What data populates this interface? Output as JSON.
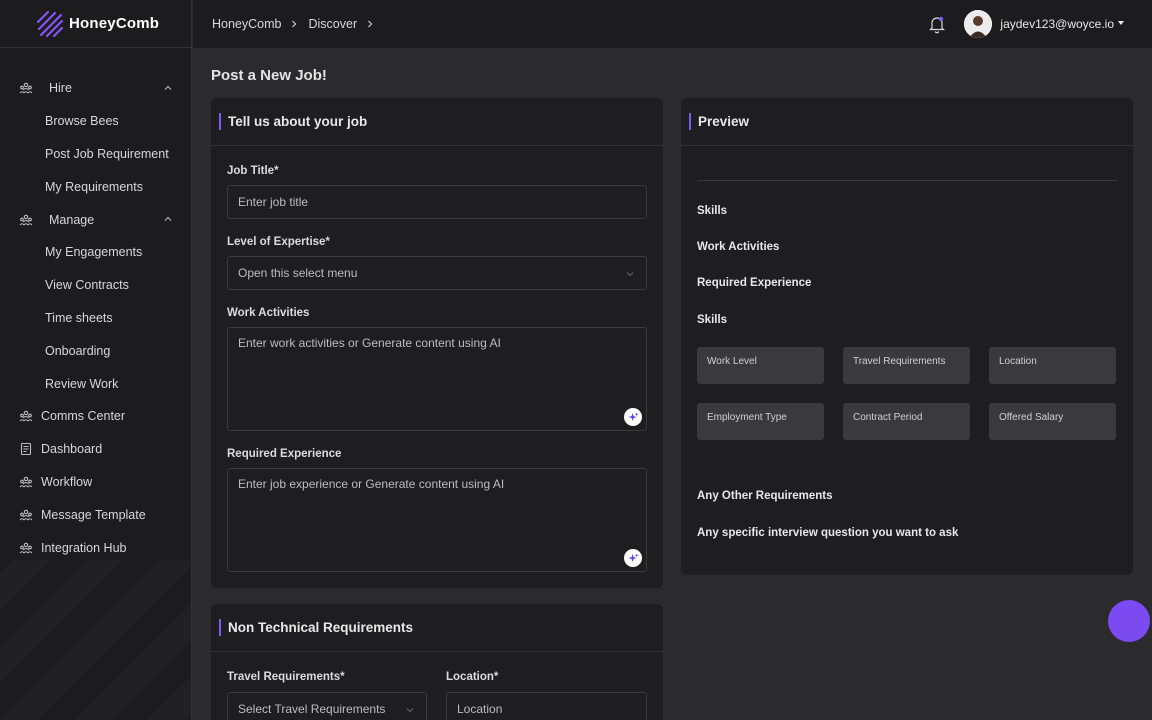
{
  "brand": {
    "name": "HoneyComb"
  },
  "sidebar": {
    "items": [
      {
        "label": "Hire",
        "icon": "people-icon",
        "type": "group"
      },
      {
        "label": "Browse Bees",
        "type": "sub"
      },
      {
        "label": "Post Job Requirement",
        "type": "sub"
      },
      {
        "label": "My Requirements",
        "type": "sub"
      },
      {
        "label": "Manage",
        "icon": "people-icon",
        "type": "group"
      },
      {
        "label": "My Engagements",
        "type": "sub"
      },
      {
        "label": "View Contracts",
        "type": "sub"
      },
      {
        "label": "Time sheets",
        "type": "sub"
      },
      {
        "label": "Onboarding",
        "type": "sub"
      },
      {
        "label": "Review Work",
        "type": "sub"
      },
      {
        "label": "Comms Center",
        "icon": "people-icon",
        "type": "top"
      },
      {
        "label": "Dashboard",
        "icon": "document-icon",
        "type": "top"
      },
      {
        "label": "Workflow",
        "icon": "people-icon",
        "type": "top"
      },
      {
        "label": "Message Template",
        "icon": "people-icon",
        "type": "top"
      },
      {
        "label": "Integration Hub",
        "icon": "people-icon",
        "type": "top"
      }
    ]
  },
  "breadcrumb": [
    "HoneyComb",
    "Discover"
  ],
  "header": {
    "user": "jaydev123@woyce.io"
  },
  "page": {
    "title": "Post a New Job!"
  },
  "job_card": {
    "title": "Tell us about your job",
    "job_title_label": "Job Title*",
    "job_title_placeholder": "Enter job title",
    "expertise_label": "Level of Expertise*",
    "expertise_value": "Open this select menu",
    "activities_label": "Work Activities",
    "activities_placeholder": "Enter work activities or Generate content using AI",
    "experience_label": "Required Experience",
    "experience_placeholder": "Enter job experience or Generate content using AI"
  },
  "non_tech_card": {
    "title": "Non Technical Requirements",
    "travel_label": "Travel Requirements*",
    "travel_value": "Select Travel Requirements",
    "location_label": "Location*",
    "location_placeholder": "Location"
  },
  "preview": {
    "title": "Preview",
    "skills_1": "Skills",
    "work_activities": "Work Activities",
    "required_experience": "Required Experience",
    "skills_2": "Skills",
    "boxes": [
      "Work Level",
      "Travel Requirements",
      "Location",
      "Employment Type",
      "Contract Period",
      "Offered Salary"
    ],
    "other_requirements": "Any Other Requirements",
    "interview_question": "Any specific interview question you want to ask"
  },
  "colors": {
    "accent": "#7b5cf0",
    "fab": "#7b4af0",
    "sidebar_bg": "#1c1c1e",
    "page_bg": "#2b2b2d",
    "card_bg": "#1e1e20"
  }
}
